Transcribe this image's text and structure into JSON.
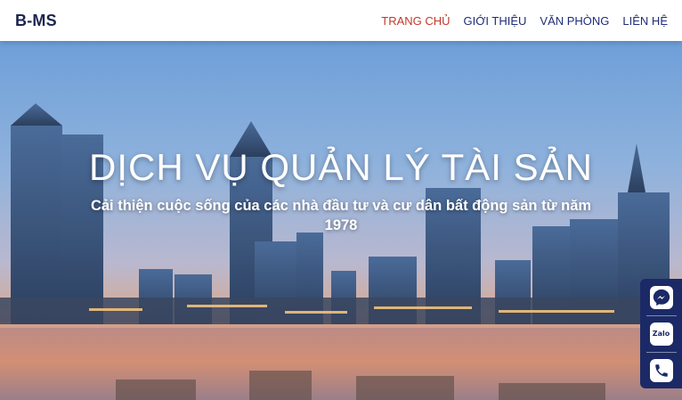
{
  "header": {
    "brand": "B-MS",
    "nav": [
      {
        "label": "TRANG CHỦ",
        "active": true
      },
      {
        "label": "GIỚI THIỆU",
        "active": false
      },
      {
        "label": "VĂN PHÒNG",
        "active": false
      },
      {
        "label": "LIÊN HỆ",
        "active": false
      }
    ]
  },
  "hero": {
    "title": "DỊCH VỤ QUẢN LÝ TÀI SẢN",
    "subtitle": "Cải thiện cuộc sống của các nhà đầu tư và cư dân bất động sản từ năm 1978"
  },
  "contact_bar": {
    "buttons": [
      {
        "icon": "messenger-icon"
      },
      {
        "icon": "zalo-icon",
        "label": "Zalo"
      },
      {
        "icon": "phone-icon"
      }
    ]
  },
  "colors": {
    "brand": "#1c2550",
    "nav_active": "#c0392b",
    "nav": "#1f2d7a",
    "contact_bar": "#1b2a66"
  }
}
